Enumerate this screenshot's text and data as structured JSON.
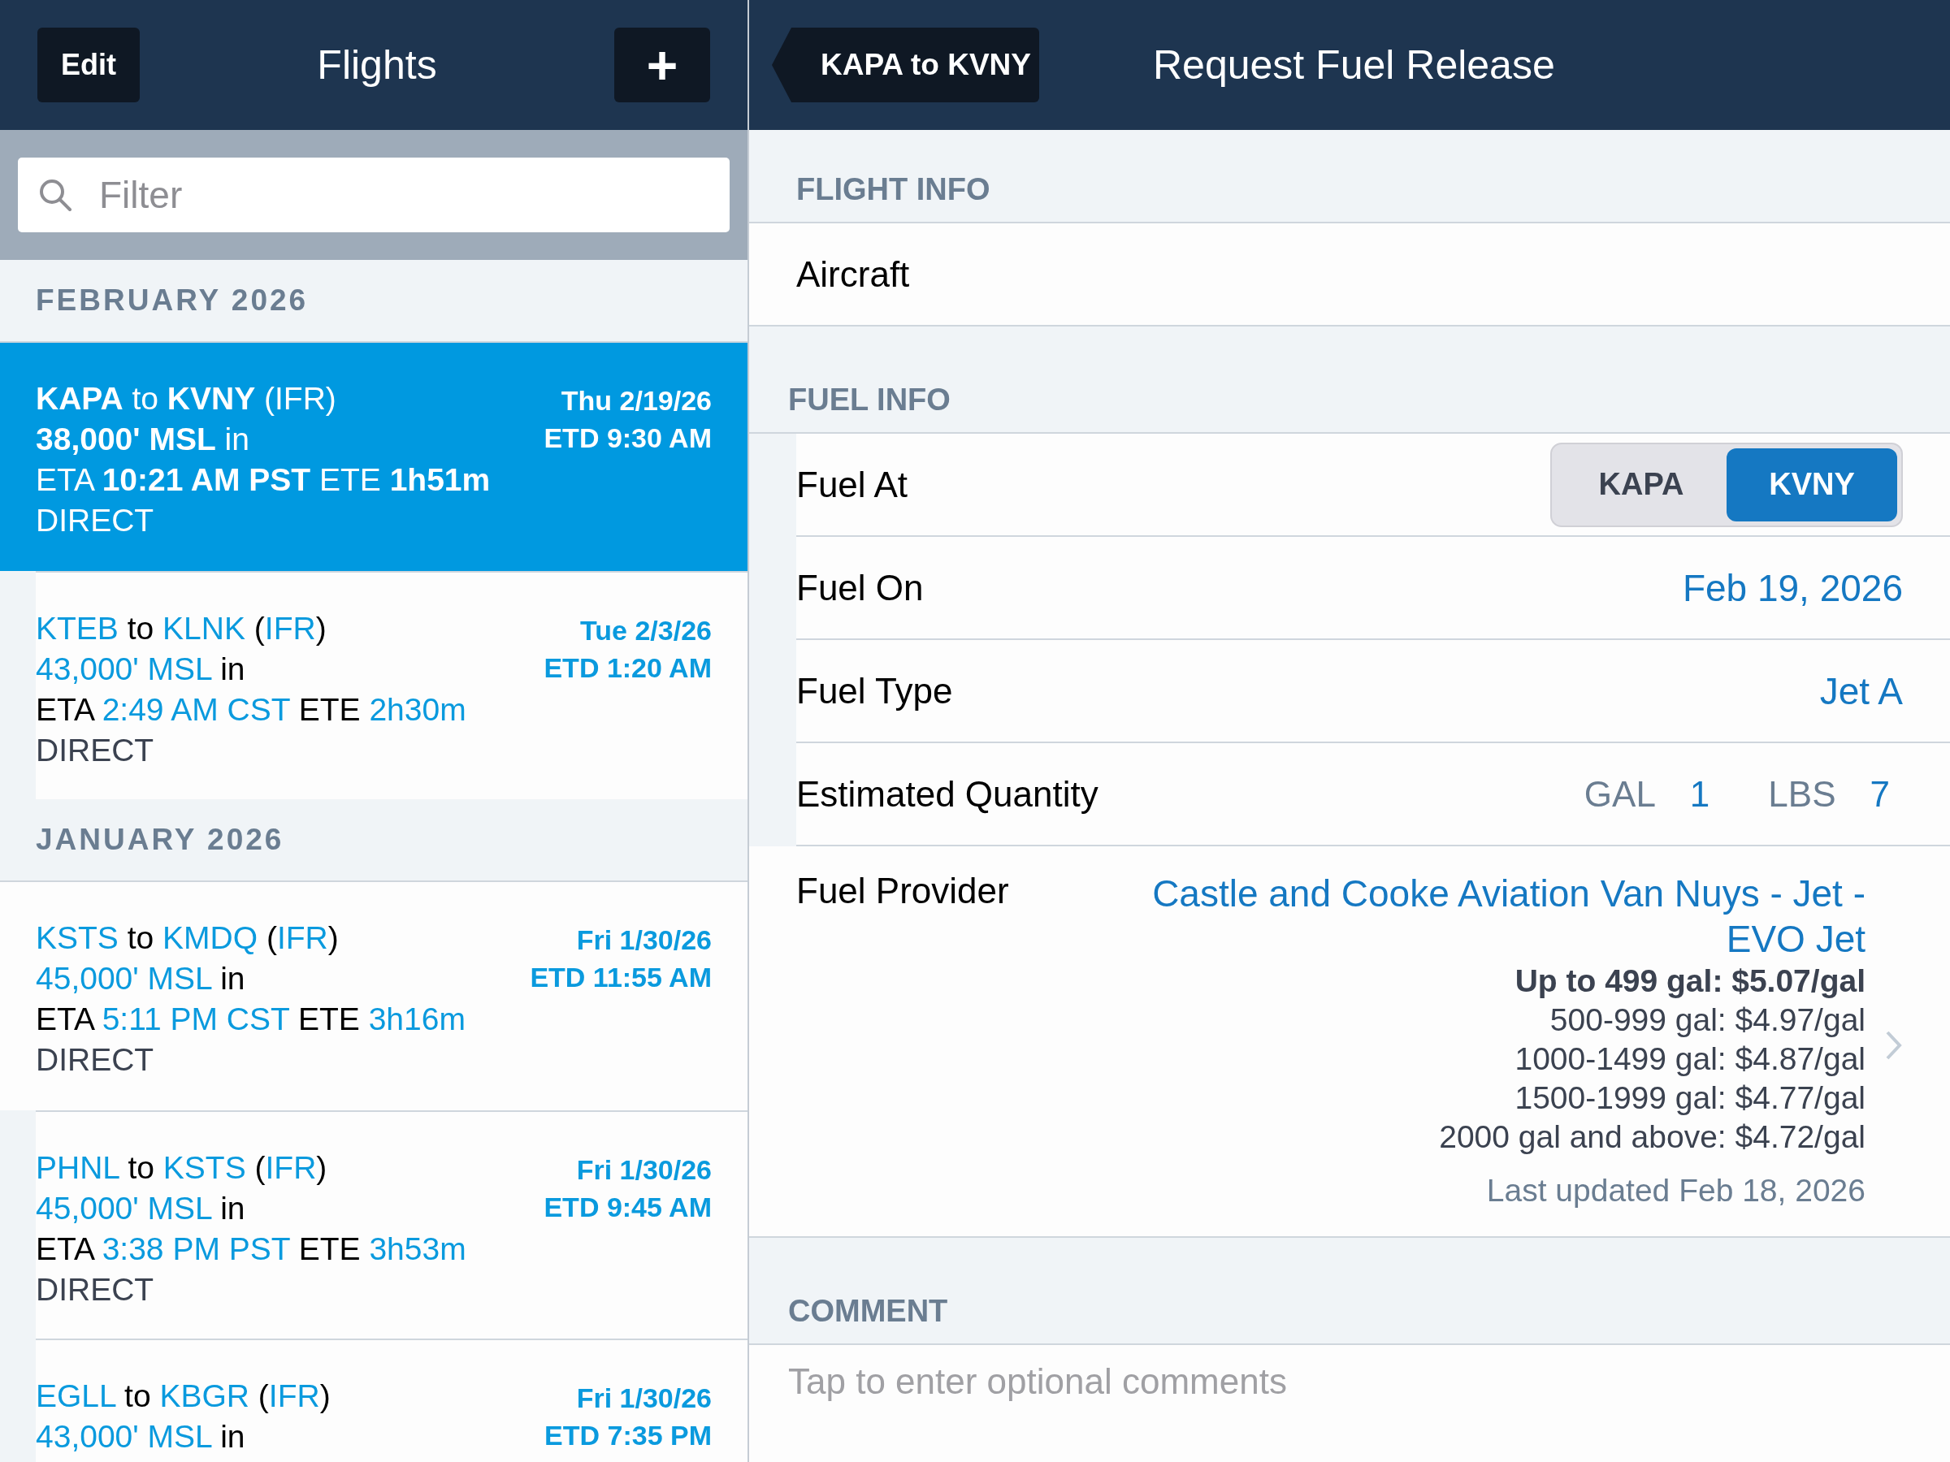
{
  "list_header": {
    "edit": "Edit",
    "title": "Flights",
    "add": "+"
  },
  "filter": {
    "placeholder": "Filter"
  },
  "sections": [
    {
      "title": "FEBRUARY 2026",
      "flights": [
        {
          "selected": true,
          "lines": [
            [
              {
                "text": "KAPA",
                "highlight": true
              },
              {
                "text": " to ",
                "highlight": false
              },
              {
                "text": "KVNY",
                "highlight": true
              },
              {
                "text": " (",
                "highlight": false
              },
              {
                "text": "IFR",
                "highlight": false
              },
              {
                "text": ")",
                "highlight": false
              }
            ],
            [
              {
                "text": "38,000' MSL",
                "highlight": true
              },
              {
                "text": " in",
                "highlight": false
              }
            ],
            [
              {
                "text": "ETA ",
                "highlight": false
              },
              {
                "text": "10:21 AM PST",
                "highlight": true
              },
              {
                "text": " ETE ",
                "highlight": false
              },
              {
                "text": "1h51m",
                "highlight": true
              }
            ]
          ],
          "route": "DIRECT",
          "date": "Thu 2/19/26",
          "etd": "ETD 9:30 AM"
        },
        {
          "selected": false,
          "lines": [
            [
              {
                "text": "KTEB",
                "highlight": true
              },
              {
                "text": " to ",
                "highlight": false
              },
              {
                "text": "KLNK",
                "highlight": true
              },
              {
                "text": " (",
                "highlight": false
              },
              {
                "text": "IFR",
                "highlight": true
              },
              {
                "text": ")",
                "highlight": false
              }
            ],
            [
              {
                "text": "43,000' MSL",
                "highlight": true
              },
              {
                "text": " in",
                "highlight": false
              }
            ],
            [
              {
                "text": "ETA ",
                "highlight": false
              },
              {
                "text": "2:49 AM CST",
                "highlight": true
              },
              {
                "text": " ETE ",
                "highlight": false
              },
              {
                "text": "2h30m",
                "highlight": true
              }
            ]
          ],
          "route": "DIRECT",
          "date": "Tue 2/3/26",
          "etd": "ETD 1:20 AM"
        }
      ]
    },
    {
      "title": "JANUARY 2026",
      "flights": [
        {
          "selected": false,
          "lines": [
            [
              {
                "text": "KSTS",
                "highlight": true
              },
              {
                "text": " to ",
                "highlight": false
              },
              {
                "text": "KMDQ",
                "highlight": true
              },
              {
                "text": " (",
                "highlight": false
              },
              {
                "text": "IFR",
                "highlight": true
              },
              {
                "text": ")",
                "highlight": false
              }
            ],
            [
              {
                "text": "45,000' MSL",
                "highlight": true
              },
              {
                "text": " in",
                "highlight": false
              }
            ],
            [
              {
                "text": "ETA ",
                "highlight": false
              },
              {
                "text": "5:11 PM CST",
                "highlight": true
              },
              {
                "text": " ETE ",
                "highlight": false
              },
              {
                "text": "3h16m",
                "highlight": true
              }
            ]
          ],
          "route": "DIRECT",
          "date": "Fri 1/30/26",
          "etd": "ETD 11:55 AM"
        },
        {
          "selected": false,
          "lines": [
            [
              {
                "text": "PHNL",
                "highlight": true
              },
              {
                "text": " to ",
                "highlight": false
              },
              {
                "text": "KSTS",
                "highlight": true
              },
              {
                "text": " (",
                "highlight": false
              },
              {
                "text": "IFR",
                "highlight": true
              },
              {
                "text": ")",
                "highlight": false
              }
            ],
            [
              {
                "text": "45,000' MSL",
                "highlight": true
              },
              {
                "text": " in",
                "highlight": false
              }
            ],
            [
              {
                "text": "ETA ",
                "highlight": false
              },
              {
                "text": "3:38 PM PST",
                "highlight": true
              },
              {
                "text": " ETE ",
                "highlight": false
              },
              {
                "text": "3h53m",
                "highlight": true
              }
            ]
          ],
          "route": "DIRECT",
          "date": "Fri 1/30/26",
          "etd": "ETD 9:45 AM"
        },
        {
          "selected": false,
          "lines": [
            [
              {
                "text": "EGLL",
                "highlight": true
              },
              {
                "text": " to ",
                "highlight": false
              },
              {
                "text": "KBGR",
                "highlight": true
              },
              {
                "text": " (",
                "highlight": false
              },
              {
                "text": "IFR",
                "highlight": true
              },
              {
                "text": ")",
                "highlight": false
              }
            ],
            [
              {
                "text": "43,000' MSL",
                "highlight": true
              },
              {
                "text": " in",
                "highlight": false
              }
            ]
          ],
          "date": "Fri 1/30/26",
          "etd": "ETD 7:35 PM"
        }
      ]
    }
  ],
  "detail_header": {
    "back": "KAPA to KVNY",
    "title": "Request Fuel Release"
  },
  "flight_info": {
    "title": "FLIGHT INFO",
    "aircraft_label": "Aircraft"
  },
  "fuel_info": {
    "title": "FUEL INFO",
    "fuel_at": {
      "label": "Fuel At",
      "options": [
        {
          "label": "KAPA",
          "selected": false
        },
        {
          "label": "KVNY",
          "selected": true
        }
      ]
    },
    "fuel_on": {
      "label": "Fuel On",
      "value": "Feb 19, 2026"
    },
    "fuel_type": {
      "label": "Fuel Type",
      "value": "Jet A"
    },
    "quantity": {
      "label": "Estimated Quantity",
      "gal_label": "GAL",
      "gal": "1",
      "lbs_label": "LBS",
      "lbs": "7"
    },
    "provider": {
      "label": "Fuel Provider",
      "name": "Castle and Cooke Aviation Van Nuys - Jet - EVO Jet",
      "tiers": [
        {
          "text": "Up to 499 gal: $5.07/gal",
          "emphasized": true
        },
        {
          "text": "500-999 gal: $4.97/gal",
          "emphasized": false
        },
        {
          "text": "1000-1499 gal: $4.87/gal",
          "emphasized": false
        },
        {
          "text": "1500-1999 gal: $4.77/gal",
          "emphasized": false
        },
        {
          "text": "2000 gal and above: $4.72/gal",
          "emphasized": false
        }
      ],
      "updated": "Last updated Feb 18, 2026"
    }
  },
  "comment": {
    "title": "COMMENT",
    "placeholder": "Tap to enter optional comments"
  }
}
